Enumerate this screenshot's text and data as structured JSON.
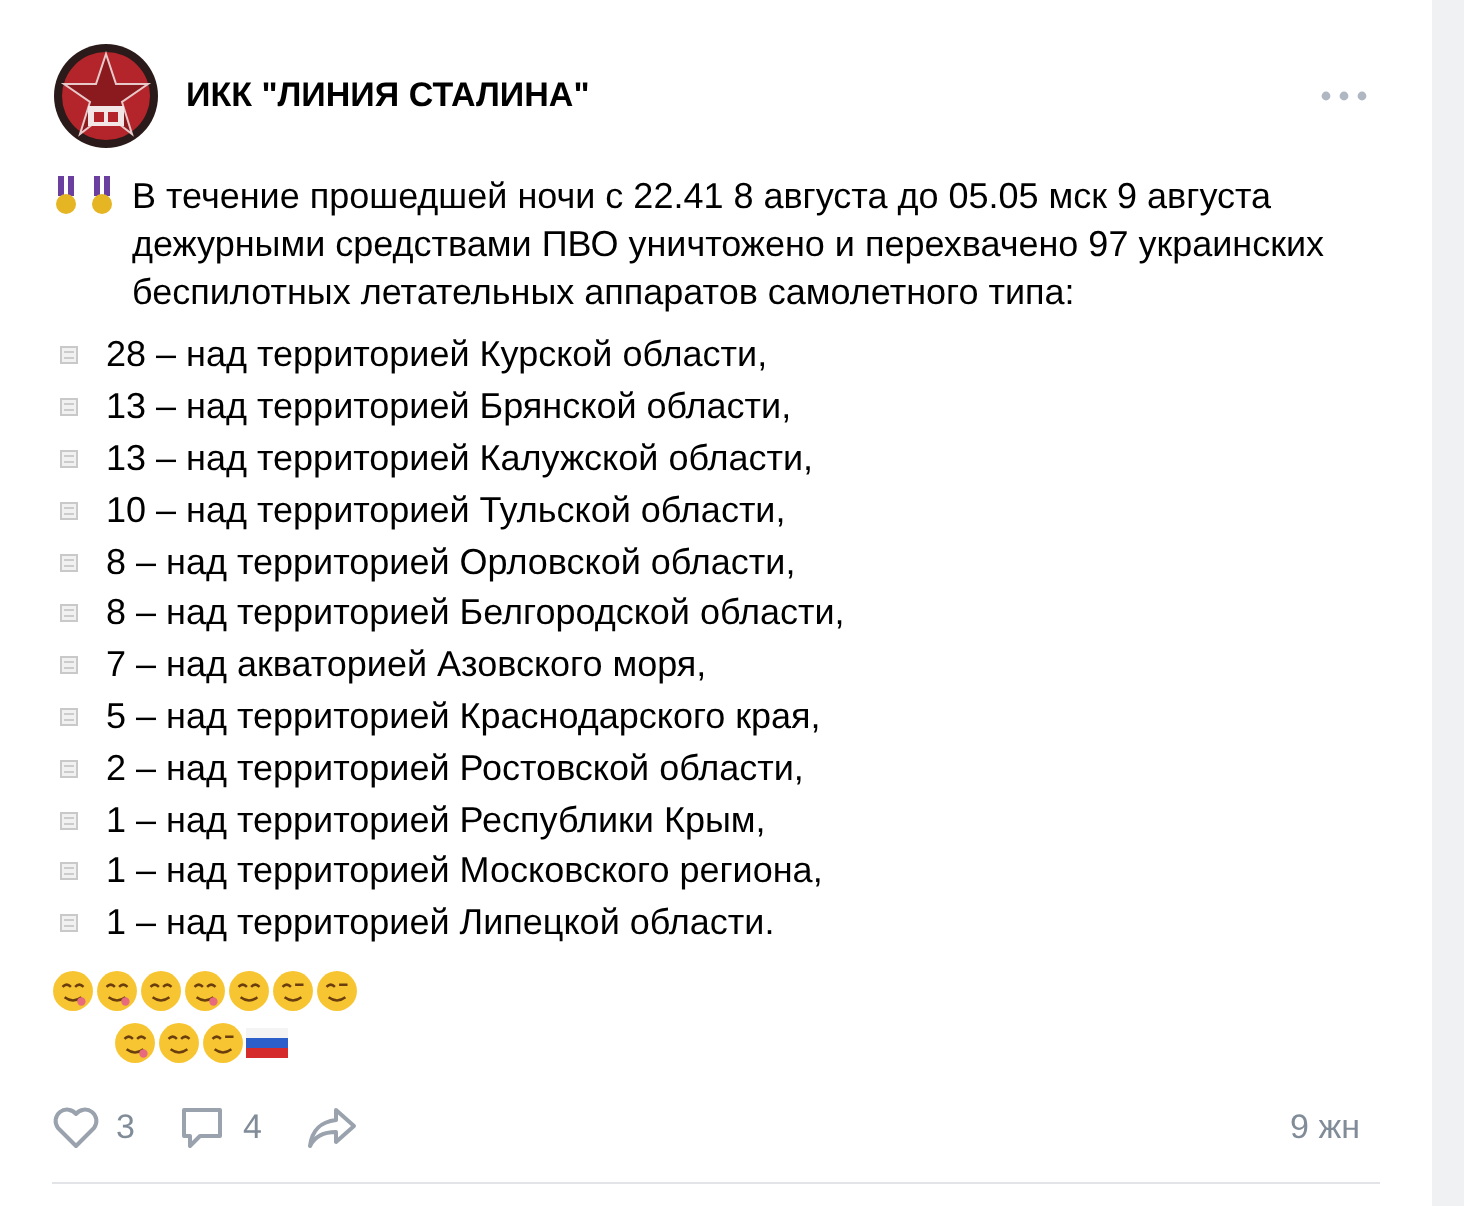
{
  "channel": {
    "name": "ИКК \"ЛИНИЯ СТАЛИНА\""
  },
  "post": {
    "intro": "В течение прошедшей ночи с 22.41 8 августа до 05.05 мск 9 августа дежурными средствами ПВО уничтожено и перехвачено 97 украинских беспилотных летательных аппаратов самолетного типа:",
    "items": [
      "28 – над территорией Курской области,",
      "13 – над территорией Брянской области,",
      "13 – над территорией Калужской области,",
      "10 – над территорией Тульской области,",
      "8 – над территорией Орловской области,",
      "8 – над территорией Белгородской области,",
      "7 – над акваторией Азовского моря,",
      "5 – над территорией Краснодарского края,",
      "2 – над территорией Ростовской области,",
      "1 – над территорией Республики Крым,",
      "1 – над территорией Московского региона,",
      "1 – над территорией Липецкой области."
    ]
  },
  "footer": {
    "likes": "3",
    "comments": "4",
    "time": "9 жн"
  }
}
